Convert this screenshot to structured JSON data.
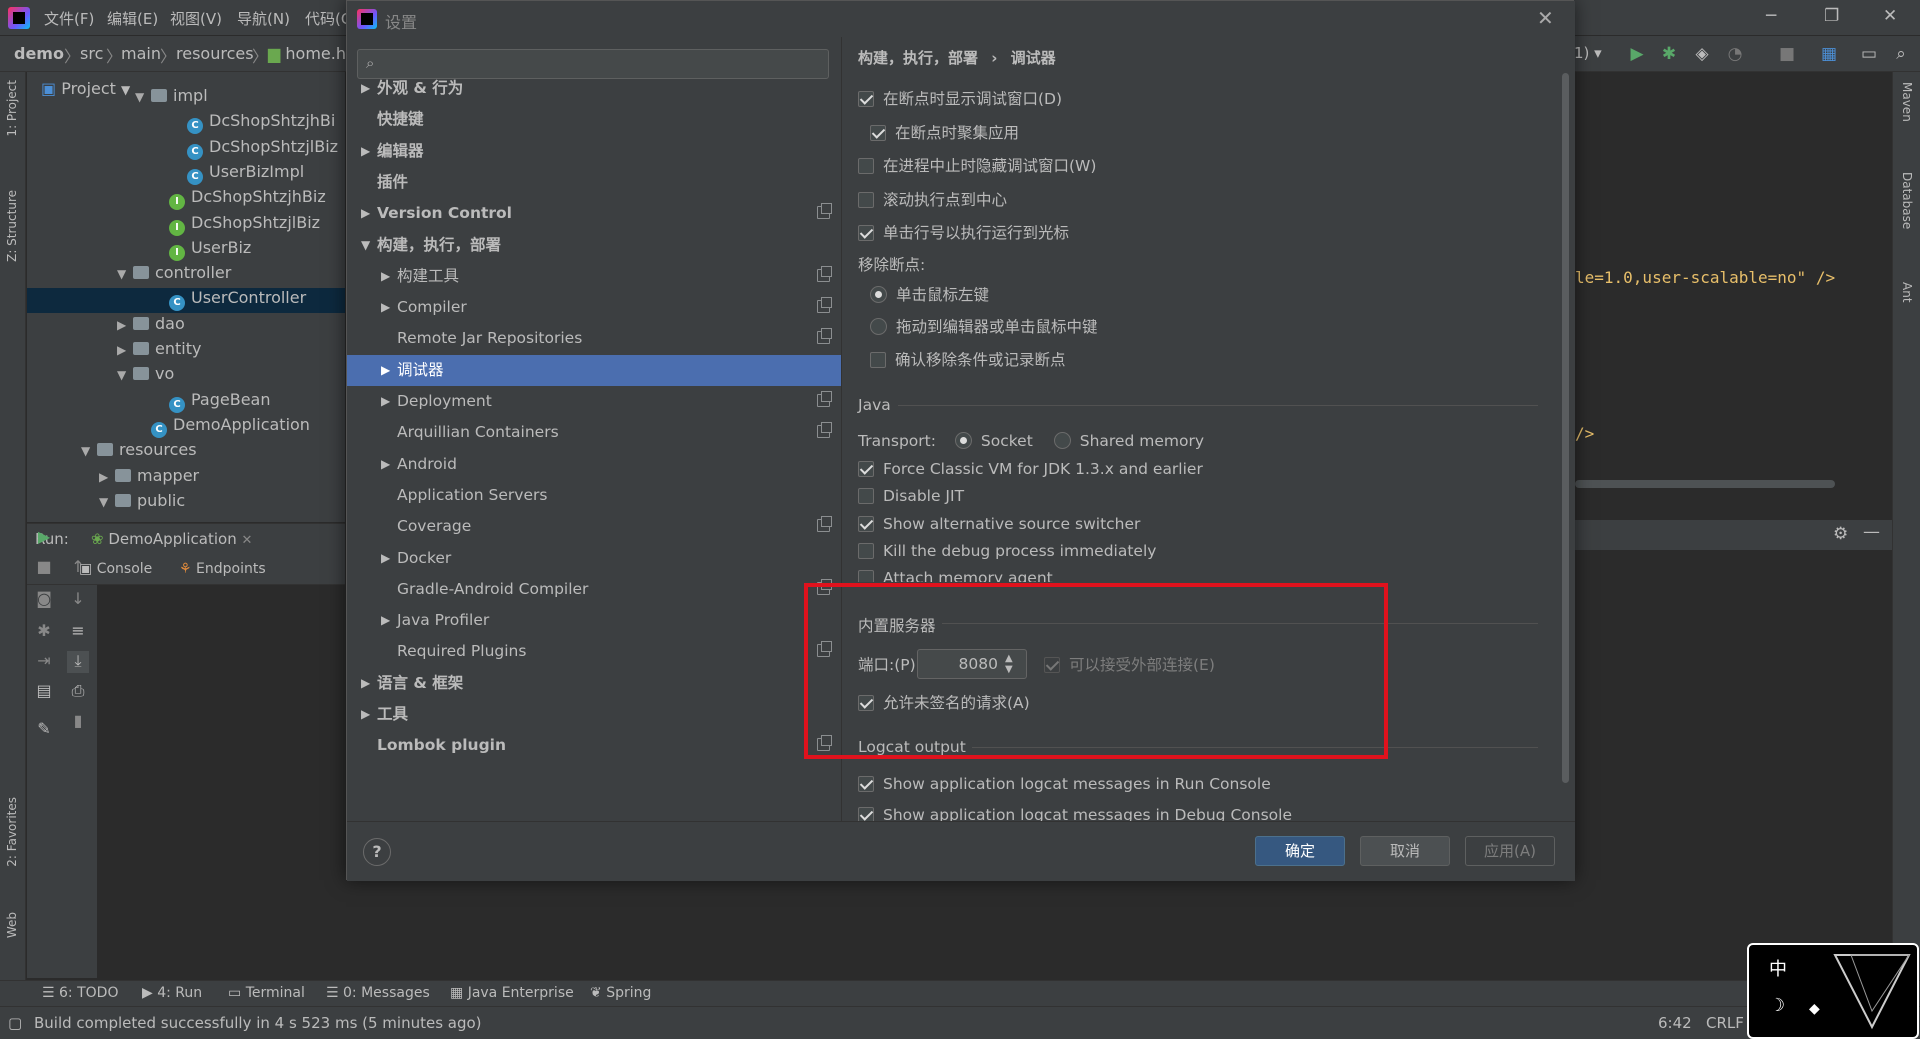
{
  "ide": {
    "menu": [
      "文件(F)",
      "编辑(E)",
      "视图(V)",
      "导航(N)",
      "代码(C"
    ],
    "breadcrumb": [
      "demo",
      "src",
      "main",
      "resources",
      "home.h"
    ],
    "run_config_fragment": "1)",
    "project_label": "Project",
    "left_tabs": [
      "1: Project",
      "Z: Structure",
      "2: Favorites",
      "Web"
    ],
    "right_tabs": [
      "Maven",
      "Database",
      "Ant"
    ],
    "tree": [
      {
        "label": "impl",
        "icon": "folder",
        "indent": 6,
        "arrow": "▼"
      },
      {
        "label": "DcShopShtzjhBi",
        "icon": "class",
        "indent": 8,
        "arrow": ""
      },
      {
        "label": "DcShopShtzjlBiz",
        "icon": "class",
        "indent": 8,
        "arrow": ""
      },
      {
        "label": "UserBizImpl",
        "icon": "class",
        "indent": 8,
        "arrow": ""
      },
      {
        "label": "DcShopShtzjhBiz",
        "icon": "interface",
        "indent": 7,
        "arrow": ""
      },
      {
        "label": "DcShopShtzjlBiz",
        "icon": "interface",
        "indent": 7,
        "arrow": ""
      },
      {
        "label": "UserBiz",
        "icon": "interface",
        "indent": 7,
        "arrow": ""
      },
      {
        "label": "controller",
        "icon": "folder",
        "indent": 5,
        "arrow": "▼"
      },
      {
        "label": "UserController",
        "icon": "class",
        "indent": 7,
        "arrow": "",
        "selected": true
      },
      {
        "label": "dao",
        "icon": "folder",
        "indent": 5,
        "arrow": "▶"
      },
      {
        "label": "entity",
        "icon": "folder",
        "indent": 5,
        "arrow": "▶"
      },
      {
        "label": "vo",
        "icon": "folder",
        "indent": 5,
        "arrow": "▼"
      },
      {
        "label": "PageBean",
        "icon": "class",
        "indent": 7,
        "arrow": ""
      },
      {
        "label": "DemoApplication",
        "icon": "app",
        "indent": 6,
        "arrow": ""
      },
      {
        "label": "resources",
        "icon": "folder",
        "indent": 3,
        "arrow": "▼"
      },
      {
        "label": "mapper",
        "icon": "folder",
        "indent": 4,
        "arrow": "▶"
      },
      {
        "label": "public",
        "icon": "folder",
        "indent": 4,
        "arrow": "▼"
      }
    ],
    "run_label": "Run:",
    "run_tab": "DemoApplication",
    "console_tab": "Console",
    "endpoints_tab": "Endpoints",
    "code_lines": [
      "le=1.0,user-scalable=no\" />",
      "/>"
    ],
    "bottom_tabs": [
      "6: TODO",
      "4: Run",
      "Terminal",
      "0: Messages",
      "Java Enterprise",
      "Spring"
    ],
    "status": "Build completed successfully in 4 s 523 ms (5 minutes ago)",
    "caret_pos": "6:42",
    "line_sep": "CRLF",
    "ime_char": "中"
  },
  "dialog": {
    "title": "设置",
    "search_placeholder": "",
    "breadcrumb": [
      "构建，执行，部署",
      "调试器"
    ],
    "sidebar": [
      {
        "label": "外观 & 行为",
        "bold": true,
        "arrow": "▶",
        "level": 0,
        "copy": false
      },
      {
        "label": "快捷键",
        "bold": true,
        "arrow": "",
        "level": 0,
        "copy": false
      },
      {
        "label": "编辑器",
        "bold": true,
        "arrow": "▶",
        "level": 0,
        "copy": false
      },
      {
        "label": "插件",
        "bold": true,
        "arrow": "",
        "level": 0,
        "copy": false
      },
      {
        "label": "Version Control",
        "bold": true,
        "arrow": "▶",
        "level": 0,
        "copy": true
      },
      {
        "label": "构建，执行，部署",
        "bold": true,
        "arrow": "▼",
        "level": 0,
        "copy": false
      },
      {
        "label": "构建工具",
        "bold": false,
        "arrow": "▶",
        "level": 1,
        "copy": true
      },
      {
        "label": "Compiler",
        "bold": false,
        "arrow": "▶",
        "level": 1,
        "copy": true
      },
      {
        "label": "Remote Jar Repositories",
        "bold": false,
        "arrow": "",
        "level": 1,
        "copy": true
      },
      {
        "label": "调试器",
        "bold": false,
        "arrow": "▶",
        "level": 1,
        "copy": false,
        "selected": true
      },
      {
        "label": "Deployment",
        "bold": false,
        "arrow": "▶",
        "level": 1,
        "copy": true
      },
      {
        "label": "Arquillian Containers",
        "bold": false,
        "arrow": "",
        "level": 1,
        "copy": true
      },
      {
        "label": "Android",
        "bold": false,
        "arrow": "▶",
        "level": 1,
        "copy": false
      },
      {
        "label": "Application Servers",
        "bold": false,
        "arrow": "",
        "level": 1,
        "copy": false
      },
      {
        "label": "Coverage",
        "bold": false,
        "arrow": "",
        "level": 1,
        "copy": true
      },
      {
        "label": "Docker",
        "bold": false,
        "arrow": "▶",
        "level": 1,
        "copy": false
      },
      {
        "label": "Gradle-Android Compiler",
        "bold": false,
        "arrow": "",
        "level": 1,
        "copy": true
      },
      {
        "label": "Java Profiler",
        "bold": false,
        "arrow": "▶",
        "level": 1,
        "copy": false
      },
      {
        "label": "Required Plugins",
        "bold": false,
        "arrow": "",
        "level": 1,
        "copy": true
      },
      {
        "label": "语言 & 框架",
        "bold": true,
        "arrow": "▶",
        "level": 0,
        "copy": false
      },
      {
        "label": "工具",
        "bold": true,
        "arrow": "▶",
        "level": 0,
        "copy": false
      },
      {
        "label": "Lombok plugin",
        "bold": true,
        "arrow": "",
        "level": 0,
        "copy": true
      }
    ],
    "options": {
      "show_debug_window": {
        "label": "在断点时显示调试窗口(D)",
        "checked": true
      },
      "focus_app": {
        "label": "在断点时聚集应用",
        "checked": true
      },
      "hide_debug_window": {
        "label": "在进程中止时隐藏调试窗口(W)",
        "checked": false
      },
      "scroll_center": {
        "label": "滚动执行点到中心",
        "checked": false
      },
      "click_line_run": {
        "label": "单击行号以执行运行到光标",
        "checked": true
      },
      "remove_bp_label": "移除断点:",
      "remove_left_click": {
        "label": "单击鼠标左键",
        "checked": true
      },
      "remove_drag": {
        "label": "拖动到编辑器或单击鼠标中键",
        "checked": false
      },
      "confirm_remove": {
        "label": "确认移除条件或记录断点",
        "checked": false
      },
      "java_section": "Java",
      "transport_label": "Transport:",
      "transport_socket": {
        "label": "Socket",
        "checked": true
      },
      "transport_shared": {
        "label": "Shared memory",
        "checked": false
      },
      "force_classic_vm": {
        "label": "Force Classic VM for JDK 1.3.x and earlier",
        "checked": true
      },
      "disable_jit": {
        "label": "Disable JIT",
        "checked": false
      },
      "alt_source": {
        "label": "Show alternative source switcher",
        "checked": true
      },
      "kill_debug": {
        "label": "Kill the debug process immediately",
        "checked": false
      },
      "attach_memory": {
        "label": "Attach memory agent",
        "checked": false
      },
      "server_section": "内置服务器",
      "port_label": "端口:(P)",
      "port_value": "8080",
      "accept_external": {
        "label": "可以接受外部连接(E)",
        "checked": true
      },
      "allow_unsigned": {
        "label": "允许未签名的请求(A)",
        "checked": true
      },
      "logcat_section": "Logcat output",
      "logcat_run": {
        "label": "Show application logcat messages in Run Console",
        "checked": true
      },
      "logcat_debug": {
        "label": "Show application logcat messages in Debug Console",
        "checked": true
      }
    },
    "buttons": {
      "ok": "确定",
      "cancel": "取消",
      "apply": "应用(A)",
      "help": "?"
    }
  }
}
